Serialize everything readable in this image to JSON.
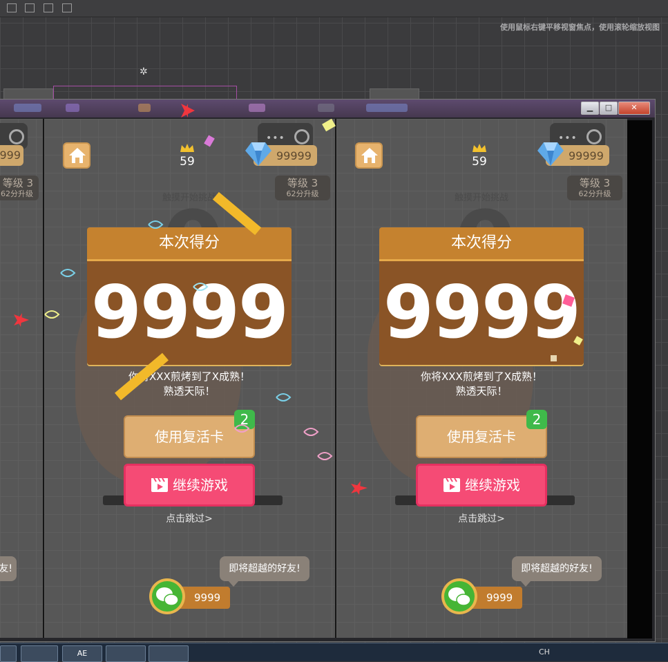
{
  "editor": {
    "hint": "使用鼠标右键平移视窗焦点，使用滚轮缩放视图"
  },
  "window": {
    "controls": [
      "▁",
      "□",
      "✕"
    ]
  },
  "game": {
    "best_score": "59",
    "diamonds": "99999",
    "level": "等级 3",
    "level_hint": "62分升级",
    "tap_hint": "触摸开始挑战",
    "score_title": "本次得分",
    "score_value": "9999",
    "message_line1": "你将XXX煎烤到了X成熟！",
    "message_line2": "熟透天际！",
    "revive_label": "使用复活卡",
    "revive_count": "2",
    "continue_label": "继续游戏",
    "skip_label": "点击跳过>",
    "friend_bubble": "即将超越的好友!",
    "friend_score": "9999"
  },
  "left_partial": {
    "diamonds": "999",
    "level": "等级 3",
    "level_hint": "62分升级",
    "bubble_tail": "友!"
  },
  "taskbar": {
    "items": [
      "AE"
    ],
    "tray_text": "CH"
  },
  "colors": {
    "score_head": "#c5822f",
    "score_body": "#8a5426",
    "continue": "#f54b75",
    "revive": "#deae72",
    "badge": "#3fb94a"
  }
}
